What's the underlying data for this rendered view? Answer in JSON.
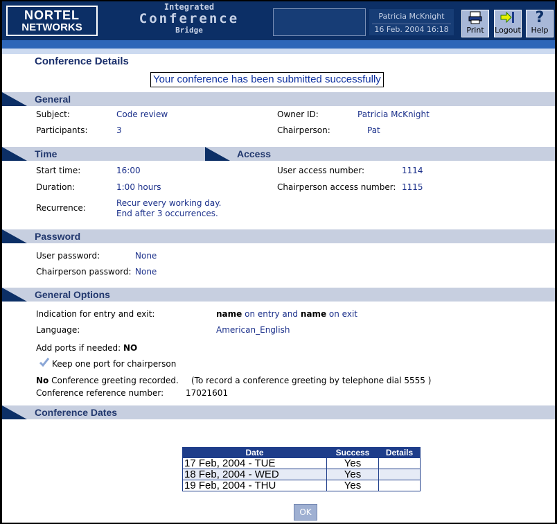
{
  "header": {
    "logo_line1": "NORTEL",
    "logo_line2": "NETWORKS",
    "app_line1": "Integrated",
    "app_line2": "Conference",
    "app_line3": "Bridge",
    "user_name": "Patricia McKnight",
    "datetime": "16 Feb. 2004 16:18",
    "print_label": "Print",
    "logout_label": "Logout",
    "help_label": "Help",
    "help_icon": "?"
  },
  "page_title": "Conference Details",
  "success_message": "Your conference has been submitted successfully",
  "general": {
    "title": "General",
    "subject_label": "Subject:",
    "subject_value": "Code review",
    "participants_label": "Participants:",
    "participants_value": "3",
    "owner_label": "Owner ID:",
    "owner_value": "Patricia McKnight",
    "chair_label": "Chairperson:",
    "chair_value": "Pat"
  },
  "time": {
    "title": "Time",
    "start_label": "Start time:",
    "start_value": "16:00",
    "duration_label": "Duration:",
    "duration_value": "1:00 hours",
    "recurrence_label": "Recurrence:",
    "recurrence_line1": "Recur every working day.",
    "recurrence_line2": "End after 3 occurrences."
  },
  "access": {
    "title": "Access",
    "user_access_label": "User access number:",
    "user_access_value": "1114",
    "chair_access_label": "Chairperson access number:",
    "chair_access_value": "1115"
  },
  "password": {
    "title": "Password",
    "user_label": "User password:",
    "user_value": "None",
    "chair_label": "Chairperson password:",
    "chair_value": "None"
  },
  "options": {
    "title": "General Options",
    "indication_label": "Indication for entry and exit:",
    "indication_bold1": "name",
    "indication_mid": " on entry and ",
    "indication_bold2": "name",
    "indication_end": " on exit",
    "language_label": "Language:",
    "language_value": "American_English",
    "add_ports_label": "Add ports if needed:",
    "add_ports_value": "NO",
    "keep_port_label": "Keep one port for chairperson",
    "greeting_bold": "No",
    "greeting_text": " Conference greeting recorded.",
    "greeting_hint": "(To record a conference greeting by telephone dial 5555 )",
    "ref_label": "Conference reference number:",
    "ref_value": "17021601"
  },
  "dates": {
    "title": "Conference Dates",
    "headers": [
      "Date",
      "Success",
      "Details"
    ],
    "rows": [
      {
        "date": "17 Feb, 2004 - TUE",
        "success": "Yes",
        "details": ""
      },
      {
        "date": "18 Feb, 2004 - WED",
        "success": "Yes",
        "details": ""
      },
      {
        "date": "19 Feb, 2004 - THU",
        "success": "Yes",
        "details": ""
      }
    ]
  },
  "ok_label": "OK"
}
